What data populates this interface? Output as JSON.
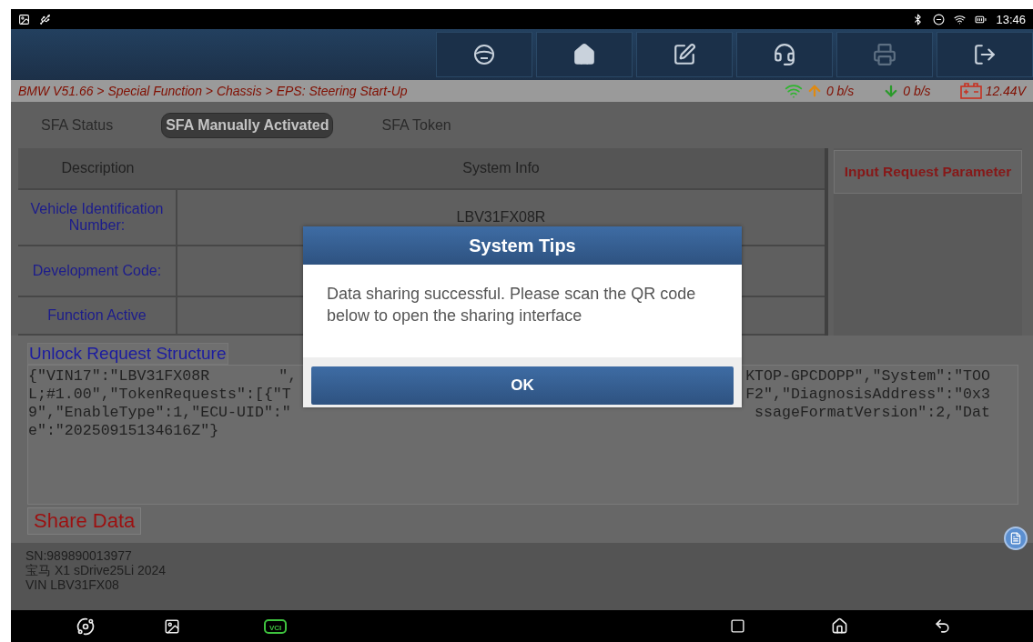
{
  "status_bar": {
    "time": "13:46"
  },
  "toolbar": [
    {
      "kind": "wheel",
      "disabled": false
    },
    {
      "kind": "home",
      "disabled": false
    },
    {
      "kind": "edit",
      "disabled": false
    },
    {
      "kind": "support",
      "disabled": false
    },
    {
      "kind": "print",
      "disabled": true
    },
    {
      "kind": "exit",
      "disabled": false
    }
  ],
  "breadcrumb": "BMW V51.66 > Special Function > Chassis > EPS: Steering Start-Up",
  "connection": {
    "upload": "0 b/s",
    "download": "0 b/s",
    "voltage": "12.44V"
  },
  "tabs": [
    {
      "label": "SFA Status",
      "selected": false
    },
    {
      "label": "SFA Manually Activated",
      "selected": true
    },
    {
      "label": "SFA Token",
      "selected": false
    }
  ],
  "table": {
    "columns": [
      "Description",
      "System Info"
    ],
    "rows": [
      {
        "label": "Vehicle Identification Number:",
        "value": "LBV31FX08R"
      },
      {
        "label": "Development Code:"
      },
      {
        "label": "Function Active"
      }
    ]
  },
  "side_button": "Input Request Parameter",
  "structure": {
    "title": "Unlock Request Structure",
    "lines": [
      {
        "left": "{\"VIN17\":\"LBV31FX08R",
        "after": "\",",
        "right": "KTOP-GPCDOPP\",\"System\":\"TOO"
      },
      {
        "left": "L;#1.00\",\"TokenRequests\":[{\"T",
        "right": "F2\",\"DiagnosisAddress\":\"0x3"
      },
      {
        "left": "9\",\"EnableType\":1,\"ECU-UID\":\"",
        "right": "ssageFormatVersion\":2,\"Dat"
      },
      {
        "left": "e\":\"20250915134616Z\"}"
      }
    ]
  },
  "share_button": "Share Data",
  "vehicle_info": {
    "sn": "SN:989890013977",
    "model": "宝马 X1 sDrive25Li 2024",
    "vin": "VIN LBV31FX08"
  },
  "dialog": {
    "title": "System Tips",
    "message": "Data sharing successful. Please scan the QR code below to open the sharing interface",
    "button": "OK"
  },
  "nav_bar": {
    "vci_label": "VCI"
  }
}
